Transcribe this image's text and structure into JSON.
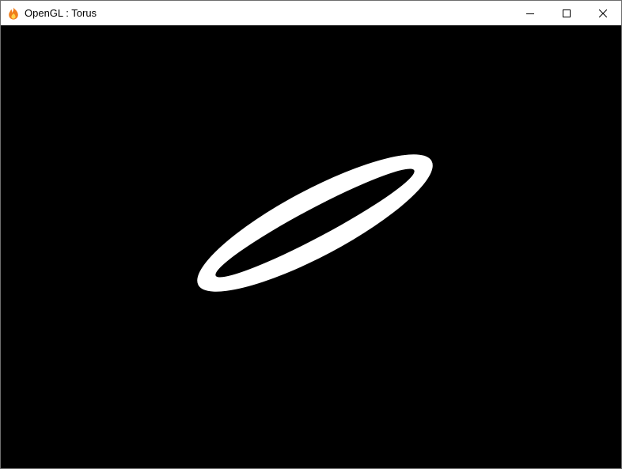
{
  "window": {
    "title": "OpenGL : Torus",
    "app_icon": "flame-app-icon",
    "controls": {
      "minimize_icon": "minimize-icon",
      "maximize_icon": "maximize-icon",
      "close_icon": "close-icon"
    }
  },
  "scene": {
    "background_color": "#000000",
    "object": "torus",
    "object_color": "#ffffff"
  }
}
